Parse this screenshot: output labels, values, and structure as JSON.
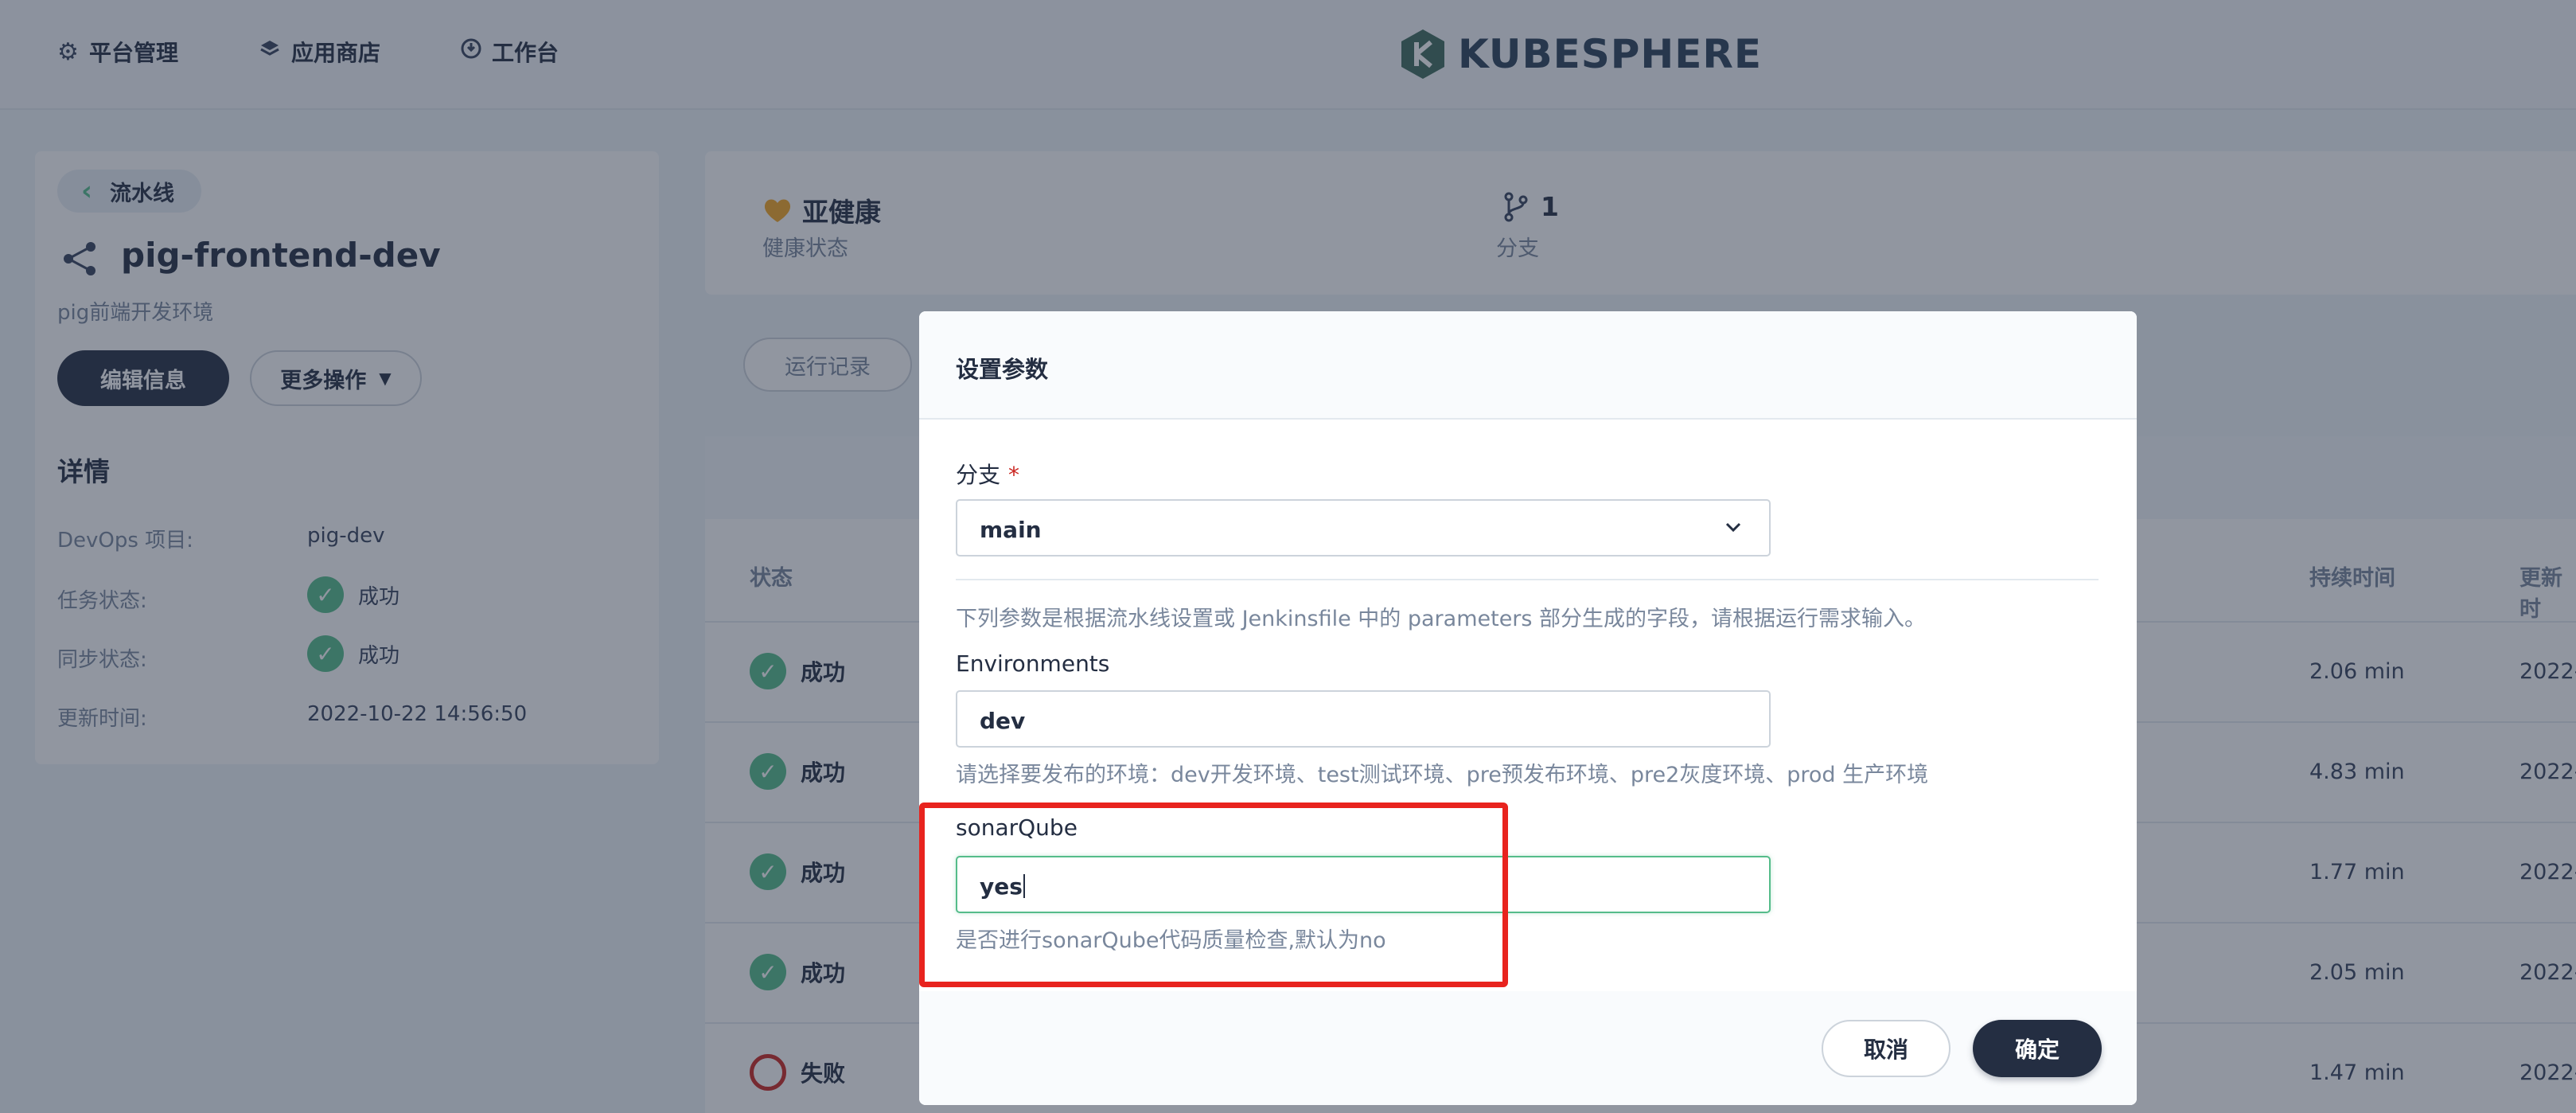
{
  "topnav": {
    "items": [
      {
        "label": "平台管理",
        "icon": "gear-icon"
      },
      {
        "label": "应用商店",
        "icon": "app-store-icon"
      },
      {
        "label": "工作台",
        "icon": "workbench-icon"
      }
    ],
    "logo_text": "KUBESPHERE"
  },
  "pipeline": {
    "back_label": "流水线",
    "name": "pig-frontend-dev",
    "description": "pig前端开发环境",
    "edit_label": "编辑信息",
    "more_label": "更多操作",
    "details_title": "详情",
    "details": [
      {
        "label": "DevOps 项目:",
        "value": "pig-dev"
      },
      {
        "label": "任务状态:",
        "value": "成功"
      },
      {
        "label": "同步状态:",
        "value": "成功"
      },
      {
        "label": "更新时间:",
        "value": "2022-10-22 14:56:50"
      }
    ]
  },
  "summary": {
    "health_value": "亚健康",
    "health_label": "健康状态",
    "branch_count": "1",
    "branch_label": "分支"
  },
  "tabs": {
    "runs_label": "运行记录"
  },
  "table": {
    "columns": {
      "status": "状态",
      "duration": "持续时间",
      "updated": "更新时"
    },
    "rows": [
      {
        "status": "成功",
        "duration": "2.06 min",
        "updated": "2022-"
      },
      {
        "status": "成功",
        "duration": "4.83 min",
        "updated": "2022-"
      },
      {
        "status": "成功",
        "duration": "1.77 min",
        "updated": "2022-"
      },
      {
        "status": "成功",
        "duration": "2.05 min",
        "updated": "2022-"
      },
      {
        "status": "失败",
        "duration": "1.47 min",
        "updated": "2022-"
      }
    ]
  },
  "modal": {
    "title": "设置参数",
    "branch_label": "分支",
    "required_mark": "*",
    "branch_value": "main",
    "params_desc": "下列参数是根据流水线设置或 Jenkinsfile 中的 parameters 部分生成的字段，请根据运行需求输入。",
    "env_label": "Environments",
    "env_value": "dev",
    "env_desc": "请选择要发布的环境：dev开发环境、test测试环境、pre预发布环境、pre2灰度环境、prod 生产环境",
    "sonar_label": "sonarQube",
    "sonar_value": "yes",
    "sonar_desc": "是否进行sonarQube代码质量检查,默认为no",
    "cancel_label": "取消",
    "ok_label": "确定"
  },
  "colors": {
    "dark": "#242e42",
    "success": "#55bc8a",
    "fail": "#ca2621",
    "annotation": "#e8231e"
  }
}
